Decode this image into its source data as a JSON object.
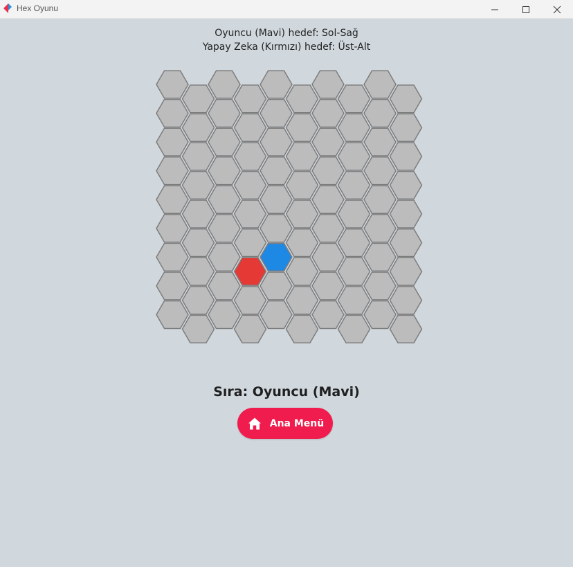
{
  "window": {
    "title": "Hex Oyunu",
    "icon": "app-logo-icon",
    "controls": [
      "minimize-icon",
      "maximize-icon",
      "close-icon"
    ]
  },
  "goals": {
    "player": "Oyuncu (Mavi) hedef: Sol-Sağ",
    "ai": "Yapay Zeka (Kırmızı) hedef: Üst-Alt"
  },
  "board": {
    "columns": 10,
    "rows": 9,
    "colors": {
      "empty": "#bcbcbc",
      "player": "#1e88e5",
      "ai": "#e53935"
    },
    "stones": [
      {
        "row": 6,
        "col": 4,
        "owner": "player"
      },
      {
        "row": 6,
        "col": 3,
        "owner": "ai"
      }
    ]
  },
  "status": {
    "turn": "Sıra: Oyuncu (Mavi)"
  },
  "main_menu_button": {
    "label": "Ana Menü",
    "icon": "home-icon",
    "color": "#f01c4d"
  }
}
